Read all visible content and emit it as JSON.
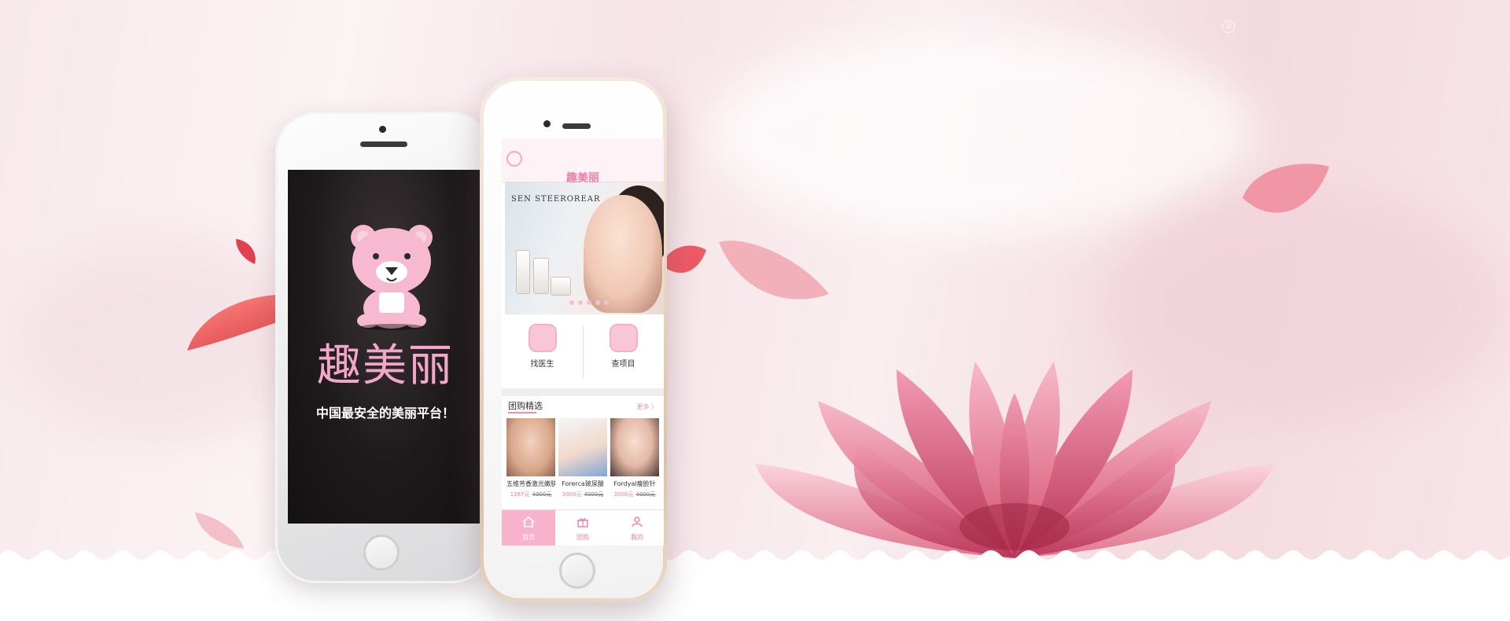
{
  "colors": {
    "accent_pink": "#f28db1",
    "title_pink": "#f2a7c8",
    "background_blush": "#f7e9ec",
    "gold_frame": "#e9d8c4"
  },
  "splash": {
    "title": "趣美丽",
    "slogan": "中国最安全的美丽平台！",
    "mascot_icon": "bear-mascot-icon"
  },
  "app": {
    "header_title": "趣美丽",
    "search_icon": "search-icon",
    "banner": {
      "brand": "SEN STEEROREAR",
      "slide_count": 5
    },
    "quick_links": [
      {
        "label": "找医生",
        "icon": "doctor-icon"
      },
      {
        "label": "查项目",
        "icon": "project-icon"
      }
    ],
    "section": {
      "title": "团购精选",
      "more": "更多 〉"
    },
    "products": [
      {
        "name": "五维芳香激光嫩肤",
        "price": "1287元",
        "original": "4000元"
      },
      {
        "name": "Forerca玻尿酸",
        "price": "3000元",
        "original": "4000元"
      },
      {
        "name": "Fordyal瘦脸针",
        "price": "3000元",
        "original": "4000元"
      }
    ],
    "tabs": [
      {
        "label": "首页",
        "icon": "home-icon",
        "active": true
      },
      {
        "label": "团购",
        "icon": "gift-icon",
        "active": false
      },
      {
        "label": "我的",
        "icon": "user-icon",
        "active": false
      }
    ]
  }
}
